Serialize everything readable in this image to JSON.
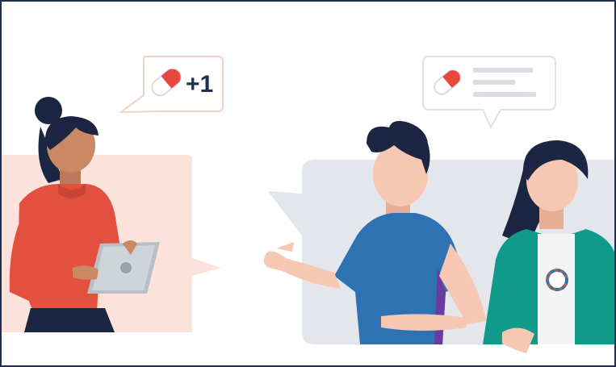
{
  "illustration": {
    "badge_text": "+1"
  },
  "colors": {
    "frame": "#1f2d4f",
    "left_backdrop": "#fbe3dc",
    "right_backdrop": "#e3e6ea",
    "pill_red": "#e8473e",
    "pill_white": "#ffffff",
    "hair_navy": "#1c2541",
    "skin_left": "#c98a63",
    "skin_right": "#f6c7b2",
    "shirt_red": "#e3503f",
    "shirt_blue": "#2f72b4",
    "jacket_teal": "#0f9a8a",
    "tablet_grey": "#cfd3da",
    "pants_navy": "#1c2541"
  },
  "icons": [
    "pill-icon",
    "pill-icon",
    "text-lines-icon",
    "logo-badge-icon"
  ]
}
